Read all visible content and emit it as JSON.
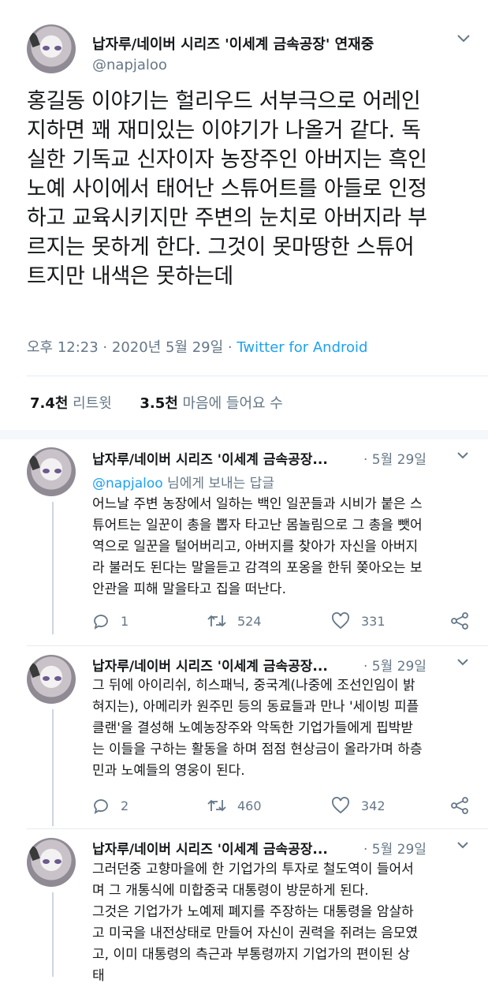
{
  "main": {
    "author_name": "납자루/네이버 시리즈 '이세계 금속공장' 연재중",
    "handle": "@napjaloo",
    "text_lines": [
      "홍길동 이야기는 헐리우드 서부극으로 어레인",
      "지하면 꽤 재미있는 이야기가 나올거 같다. 독",
      "실한 기독교 신자이자 농장주인 아버지는 흑인",
      "노예 사이에서 태어난 스튜어트를 아들로 인정",
      "하고 교육시키지만 주변의 눈치로 아버지라 부",
      "르지는 못하게 한다. 그것이 못마땅한 스튜어",
      "트지만 내색은 못하는데"
    ],
    "time": "오후 12:23 · 2020년 5월 29일 · ",
    "source": "Twitter for Android",
    "retweets_count": "7.4천",
    "retweets_label": " 리트윗",
    "likes_count": "3.5천",
    "likes_label": " 마음에 들어요 수"
  },
  "replies": [
    {
      "name": "납자루/네이버 시리즈 '이세계 금속공장...",
      "date": "· 5월 29일",
      "reply_to_handle": "@napjaloo",
      "reply_to_suffix": " 님에게 보내는 답글",
      "text_lines": [
        "어느날 주변 농장에서 일하는 백인 일꾼들과 시비가 붙은 스",
        "튜어트는 일꾼이 총을 뽑자 타고난 몸놀림으로 그 총을 뺏어",
        "역으로 일꾼을 털어버리고, 아버지를 찾아가 자신을 아버지",
        "라 불러도 된다는 말을듣고 감격의 포옹을 한뒤 쫒아오는 보",
        "안관을 피해 말을타고 집을 떠난다."
      ],
      "replies": "1",
      "retweets": "524",
      "likes": "331"
    },
    {
      "name": "납자루/네이버 시리즈 '이세계 금속공장...",
      "date": "· 5월 29일",
      "text_lines": [
        "그 뒤에 아이리쉬, 히스패닉, 중국계(나중에 조선인임이 밝",
        "혀지는), 아메리카 원주민 등의 동료들과 만나 '세이빙 피플",
        "클랜'을 결성해 노예농장주와 악독한 기업가들에게 핍박받",
        "는 이들을 구하는 활동을 하며 점점 현상금이 올라가며 하층",
        "민과 노예들의 영웅이 된다."
      ],
      "replies": "2",
      "retweets": "460",
      "likes": "342"
    },
    {
      "name": "납자루/네이버 시리즈 '이세계 금속공장...",
      "date": "· 5월 29일",
      "text_lines": [
        "그러던중 고향마을에 한 기업가의 투자로 철도역이 들어서",
        "며 그 개통식에 미합중국 대통령이 방문하게 된다.",
        "그것은 기업가가 노예제 폐지를 주장하는 대통령을 암살하",
        "고 미국을 내전상태로 만들어 자신이 권력을 쥐려는 음모였",
        "고, 이미 대통령의 측근과 부통령까지 기업가의 편이된 상",
        "태"
      ]
    }
  ],
  "icons": [
    "chevron-down-icon",
    "reply-icon",
    "retweet-icon",
    "like-icon",
    "share-icon"
  ],
  "colors": {
    "link_blue": "#1da1f2",
    "secondary_gray": "#657786",
    "text": "#14171a"
  }
}
